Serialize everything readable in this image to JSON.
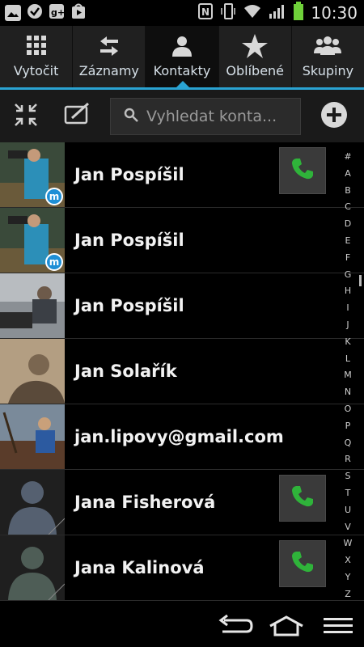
{
  "status_bar": {
    "time": "10:30",
    "left_icons": [
      "gallery-icon",
      "check-icon",
      "google-plus-icon",
      "play-store-icon"
    ],
    "right_icons": [
      "nfc-icon",
      "vibrate-icon",
      "wifi-icon",
      "signal-icon",
      "battery-icon"
    ]
  },
  "tabs": [
    {
      "label": "Vytočit",
      "icon": "dialpad-icon"
    },
    {
      "label": "Záznamy",
      "icon": "call-log-icon"
    },
    {
      "label": "Kontakty",
      "icon": "contacts-icon",
      "active": true
    },
    {
      "label": "Oblíbené",
      "icon": "star-icon"
    },
    {
      "label": "Skupiny",
      "icon": "groups-icon"
    }
  ],
  "toolbar": {
    "search_placeholder": "Vyhledat konta...",
    "icons": [
      "collapse-icon",
      "edit-icon",
      "search-icon",
      "add-icon"
    ]
  },
  "contacts": [
    {
      "name": "Jan Pospíšil",
      "has_call": true,
      "badge": "m"
    },
    {
      "name": "Jan Pospíšil",
      "has_call": false,
      "badge": "m"
    },
    {
      "name": "Jan Pospíšil",
      "has_call": false
    },
    {
      "name": "Jan Solařík",
      "has_call": false
    },
    {
      "name": "jan.lipovy@gmail.com",
      "has_call": false
    },
    {
      "name": "Jana Fisherová",
      "has_call": true
    },
    {
      "name": "Jana Kalinová",
      "has_call": true
    }
  ],
  "alphabet_index": [
    "#",
    "A",
    "B",
    "C",
    "D",
    "E",
    "F",
    "G",
    "H",
    "I",
    "J",
    "K",
    "L",
    "M",
    "N",
    "O",
    "P",
    "Q",
    "R",
    "S",
    "T",
    "U",
    "V",
    "W",
    "X",
    "Y",
    "Z"
  ],
  "colors": {
    "accent": "#2aa3d2",
    "call_green": "#2fb33a",
    "background": "#000000"
  }
}
